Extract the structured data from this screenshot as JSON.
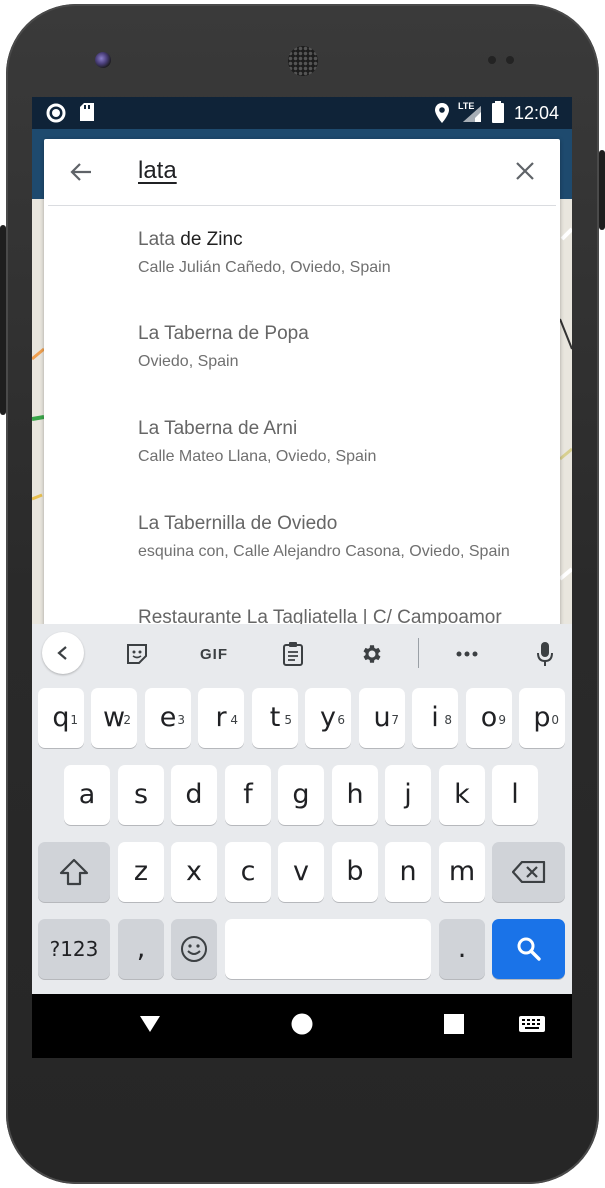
{
  "status_bar": {
    "time": "12:04",
    "network": "LTE"
  },
  "search": {
    "query": "lata",
    "back_icon": "arrow-left-icon",
    "clear_icon": "close-icon"
  },
  "suggestions": [
    {
      "title_match": "Lata",
      "title_rest": " de Zinc",
      "subtitle": "Calle Julián Cañedo, Oviedo, Spain"
    },
    {
      "title_match": "",
      "title_rest": "La Taberna de Popa",
      "subtitle": "Oviedo, Spain"
    },
    {
      "title_match": "",
      "title_rest": "La Taberna de Arni",
      "subtitle": "Calle Mateo Llana, Oviedo, Spain"
    },
    {
      "title_match": "",
      "title_rest": "La Tabernilla de Oviedo",
      "subtitle": "esquina con, Calle Alejandro Casona, Oviedo, Spain"
    },
    {
      "title_match": "",
      "title_rest": "Restaurante La Tagliatella | C/ Campoamor",
      "subtitle": ""
    }
  ],
  "keyboard": {
    "toolbar": {
      "gif": "GIF"
    },
    "row1": [
      {
        "k": "q",
        "h": "1"
      },
      {
        "k": "w",
        "h": "2"
      },
      {
        "k": "e",
        "h": "3"
      },
      {
        "k": "r",
        "h": "4"
      },
      {
        "k": "t",
        "h": "5"
      },
      {
        "k": "y",
        "h": "6"
      },
      {
        "k": "u",
        "h": "7"
      },
      {
        "k": "i",
        "h": "8"
      },
      {
        "k": "o",
        "h": "9"
      },
      {
        "k": "p",
        "h": "0"
      }
    ],
    "row2": [
      "a",
      "s",
      "d",
      "f",
      "g",
      "h",
      "j",
      "k",
      "l"
    ],
    "row3": [
      "z",
      "x",
      "c",
      "v",
      "b",
      "n",
      "m"
    ],
    "symbols": "?123",
    "comma": ",",
    "period": "."
  },
  "colors": {
    "accent": "#1a73e8",
    "status_bar": "#0f2338"
  }
}
